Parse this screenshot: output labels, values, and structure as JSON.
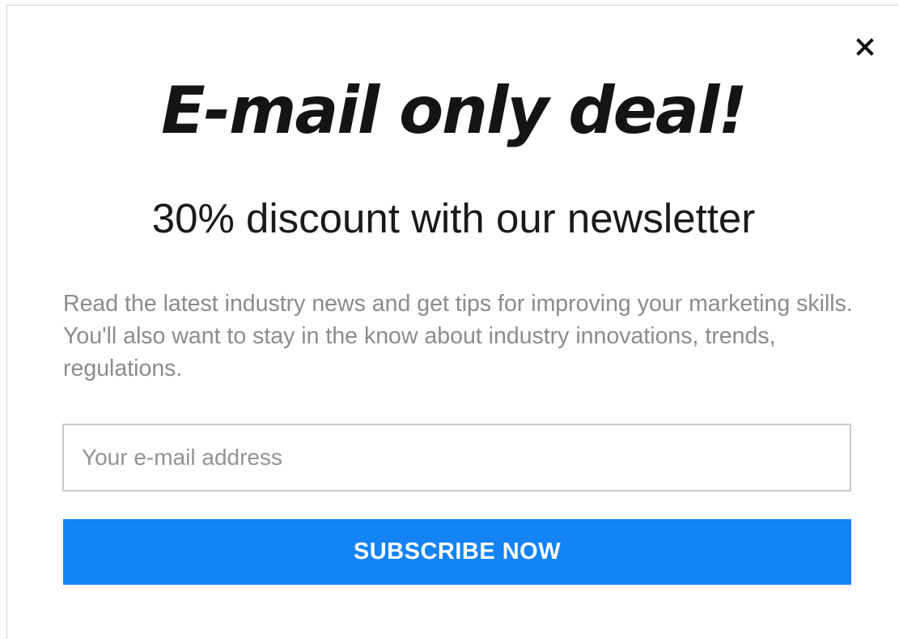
{
  "popup": {
    "close_icon": "close-icon",
    "headline": "E-mail only deal!",
    "subtitle": "30% discount with our newsletter",
    "description": "Read the latest industry news and get tips for improving your marketing skills. You'll also want to stay in the know about industry innovations, trends, regulations.",
    "email_input": {
      "value": "",
      "placeholder": "Your e-mail address"
    },
    "subscribe_label": "SUBSCRIBE NOW"
  },
  "colors": {
    "accent": "#1383f5",
    "headline": "#141414",
    "muted_text": "#8c8c8c"
  }
}
